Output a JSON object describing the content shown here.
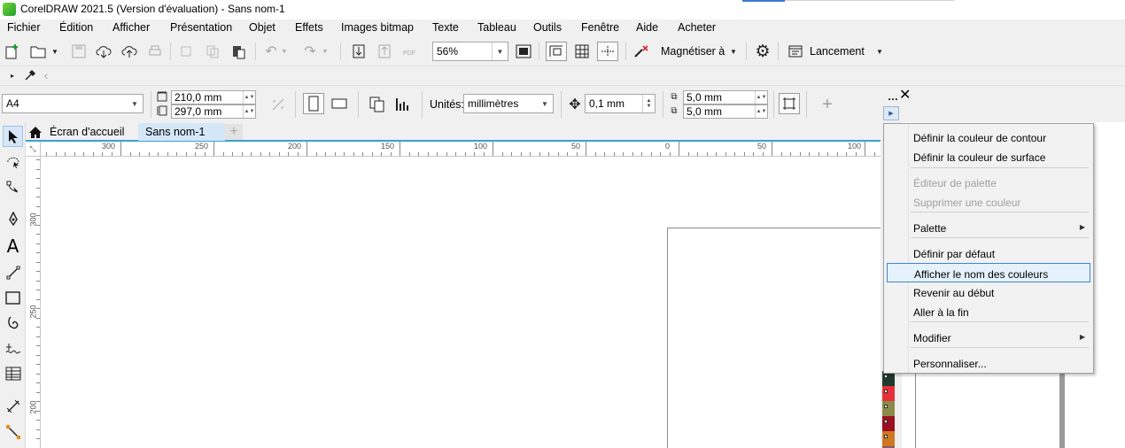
{
  "window": {
    "title": "CorelDRAW 2021.5 (Version d'évaluation) - Sans nom-1"
  },
  "menu": [
    "Fichier",
    "Édition",
    "Afficher",
    "Présentation",
    "Objet",
    "Effets",
    "Images bitmap",
    "Texte",
    "Tableau",
    "Outils",
    "Fenêtre",
    "Aide",
    "Acheter"
  ],
  "toolbar": {
    "zoom": "56%",
    "snap_label": "Magnétiser à",
    "launch_label": "Lancement",
    "pdf_label": "PDF"
  },
  "propbar": {
    "page_size": "A4",
    "width": "210,0 mm",
    "height": "297,0 mm",
    "units_label": "Unités:",
    "units_value": "millimètres",
    "nudge": "0,1 mm",
    "dup_x": "5,0 mm",
    "dup_y": "5,0 mm"
  },
  "tabs": {
    "home": "Écran d'accueil",
    "document": "Sans nom-1"
  },
  "rulers": {
    "h_labels": [
      "300",
      "250",
      "200",
      "150",
      "100",
      "50",
      "0",
      "50",
      "100"
    ],
    "v_labels": [
      "300",
      "250",
      "200"
    ]
  },
  "palette": {
    "swatches": [
      "#1f3a2a",
      "#e8303a",
      "#8a8a4a",
      "#9a1020",
      "#d07820",
      "#8a5a6a"
    ]
  },
  "context_menu": {
    "items": [
      {
        "label": "Définir la couleur de contour",
        "disabled": false
      },
      {
        "label": "Définir la couleur de surface",
        "disabled": false
      },
      {
        "label": "Éditeur de palette",
        "disabled": true
      },
      {
        "label": "Supprimer une couleur",
        "disabled": true
      },
      {
        "label": "Palette",
        "submenu": true
      },
      {
        "label": "Définir par défaut"
      },
      {
        "label": "Afficher le nom des couleurs",
        "highlighted": true
      },
      {
        "label": "Revenir au début"
      },
      {
        "label": "Aller à la fin"
      },
      {
        "label": "Modifier",
        "submenu": true
      },
      {
        "label": "Personnaliser..."
      }
    ]
  }
}
